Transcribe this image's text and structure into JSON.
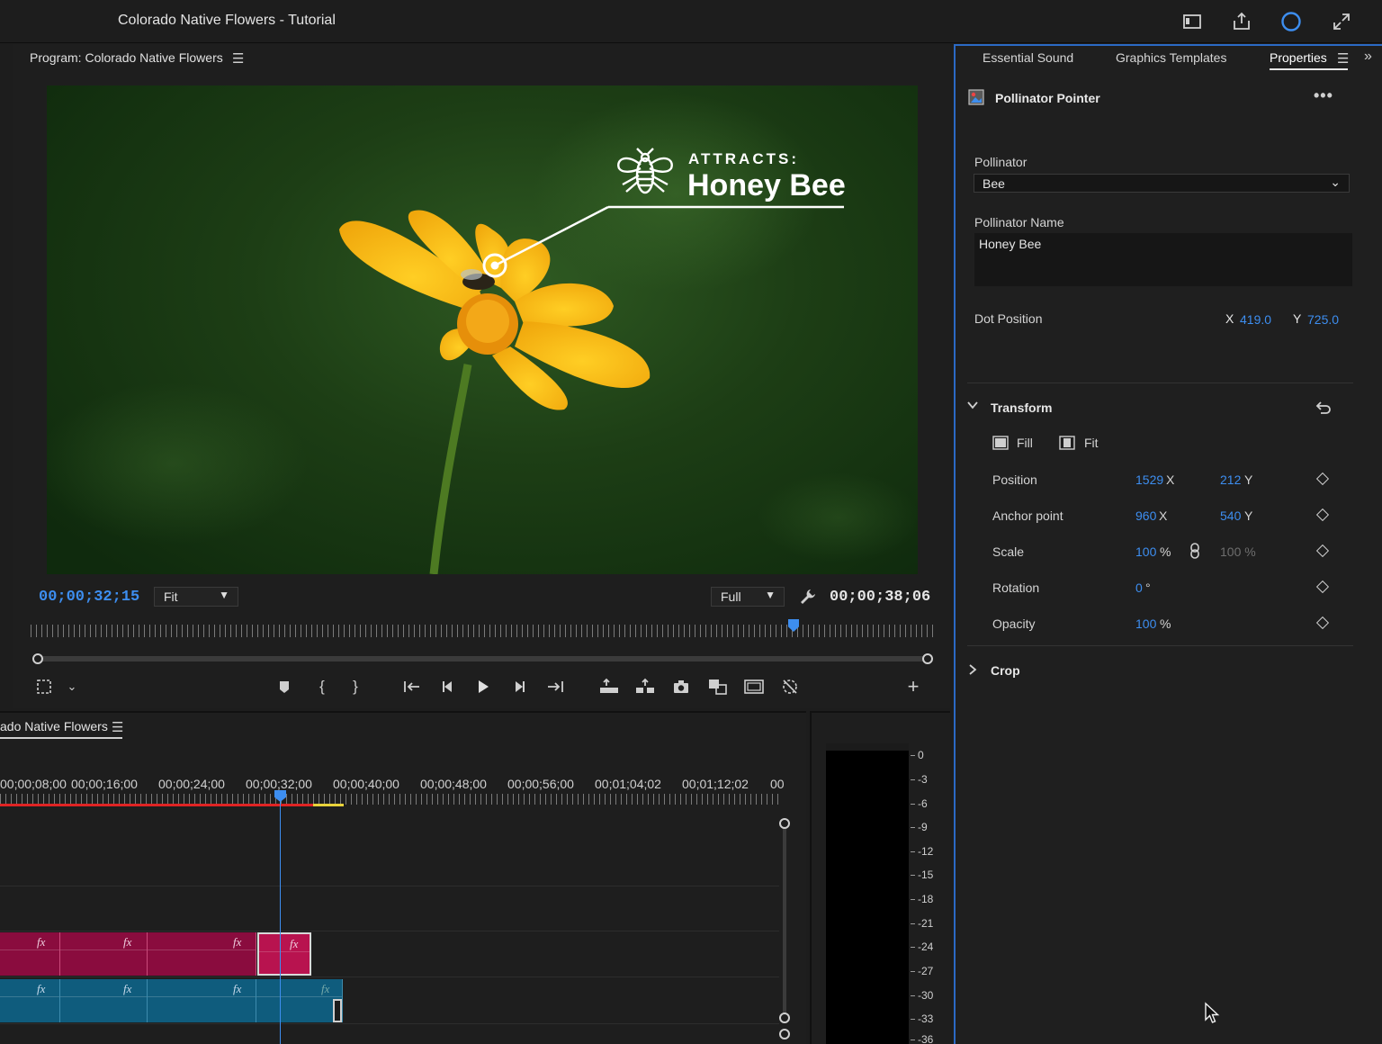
{
  "window": {
    "title": "Colorado Native Flowers - Tutorial"
  },
  "program_monitor": {
    "title": "Program: Colorado Native Flowers",
    "overlay": {
      "eyebrow": "ATTRACTS:",
      "headline": "Honey Bee"
    },
    "current_timecode": "00;00;32;15",
    "fit_label": "Fit",
    "resolution_label": "Full",
    "duration_timecode": "00;00;38;06"
  },
  "timeline": {
    "sequence_tab": "ado Native Flowers",
    "ruler_labels": [
      "00;00;08;00",
      "00;00;16;00",
      "00;00;24;00",
      "00;00;32;00",
      "00;00;40;00",
      "00;00;48;00",
      "00;00;56;00",
      "00;01;04;02",
      "00;01;12;02",
      "00"
    ],
    "fx_label": "fx"
  },
  "audio_meter": {
    "db_labels": [
      "0",
      "-3",
      "-6",
      "-9",
      "-12",
      "-15",
      "-18",
      "-21",
      "-24",
      "-27",
      "-30",
      "-33",
      "-36"
    ]
  },
  "properties_panel": {
    "tabs": [
      "Essential Sound",
      "Graphics Templates",
      "Properties"
    ],
    "active_tab": "Properties",
    "clip_name": "Pollinator Pointer",
    "pollinator": {
      "label": "Pollinator",
      "value": "Bee"
    },
    "pollinator_name": {
      "label": "Pollinator Name",
      "value": "Honey Bee"
    },
    "dot_position": {
      "label": "Dot Position",
      "x_label": "X",
      "x": "419.0",
      "y_label": "Y",
      "y": "725.0"
    },
    "transform": {
      "label": "Transform",
      "fill_label": "Fill",
      "fit_label": "Fit",
      "position": {
        "label": "Position",
        "x": "1529",
        "x_unit": "X",
        "y": "212",
        "y_unit": "Y"
      },
      "anchor_point": {
        "label": "Anchor point",
        "x": "960",
        "x_unit": "X",
        "y": "540",
        "y_unit": "Y"
      },
      "scale": {
        "label": "Scale",
        "value": "100",
        "unit": "%",
        "linked_value": "100 %"
      },
      "rotation": {
        "label": "Rotation",
        "value": "0",
        "unit": "°"
      },
      "opacity": {
        "label": "Opacity",
        "value": "100",
        "unit": "%"
      }
    },
    "crop": {
      "label": "Crop"
    }
  },
  "colors": {
    "accent": "#3d8ef0",
    "panel_border": "#2b69c4",
    "video_clip": "#8a0c3e",
    "audio_clip": "#0f5c7d"
  }
}
